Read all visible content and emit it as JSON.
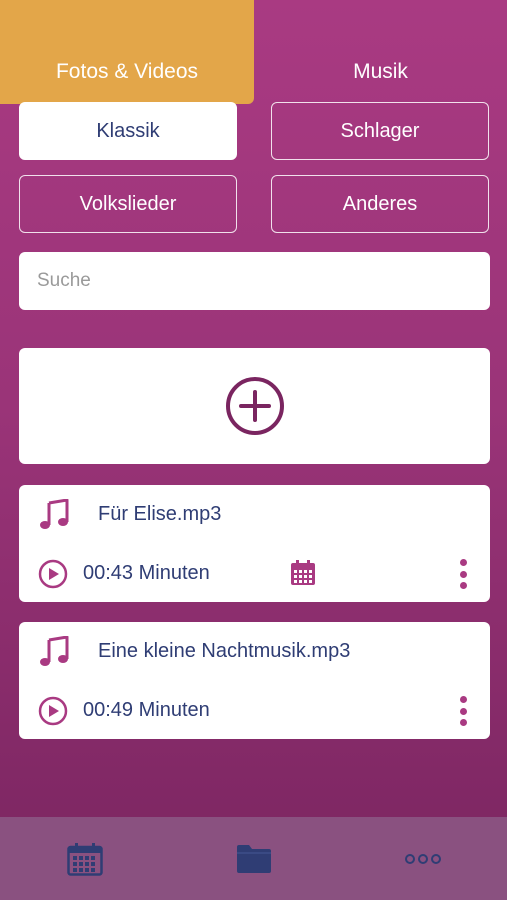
{
  "tabs": [
    {
      "label": "Fotos & Videos",
      "active": true
    },
    {
      "label": "Musik",
      "active": false
    }
  ],
  "categories": [
    {
      "label": "Klassik",
      "active": true
    },
    {
      "label": "Schlager",
      "active": false
    },
    {
      "label": "Volkslieder",
      "active": false
    },
    {
      "label": "Anderes",
      "active": false
    }
  ],
  "search": {
    "placeholder": "Suche",
    "value": ""
  },
  "add_button": {
    "icon": "plus-circle-icon"
  },
  "items": [
    {
      "title": "Für Elise.mp3",
      "duration": "00:43 Minuten",
      "icon": "music-note-icon",
      "has_calendar": true
    },
    {
      "title": "Eine kleine Nachtmusik.mp3",
      "duration": "00:49 Minuten",
      "icon": "music-note-icon",
      "has_calendar": false
    }
  ],
  "bottom_nav": [
    {
      "icon": "calendar-icon"
    },
    {
      "icon": "folder-icon"
    },
    {
      "icon": "more-horizontal-icon"
    }
  ],
  "colors": {
    "accent_orange": "#e3a649",
    "background_magenta": "#a93a82",
    "text_navy": "#2f3d74",
    "bottom_bar": "#8a5180",
    "icon_magenta": "#a93a82"
  }
}
